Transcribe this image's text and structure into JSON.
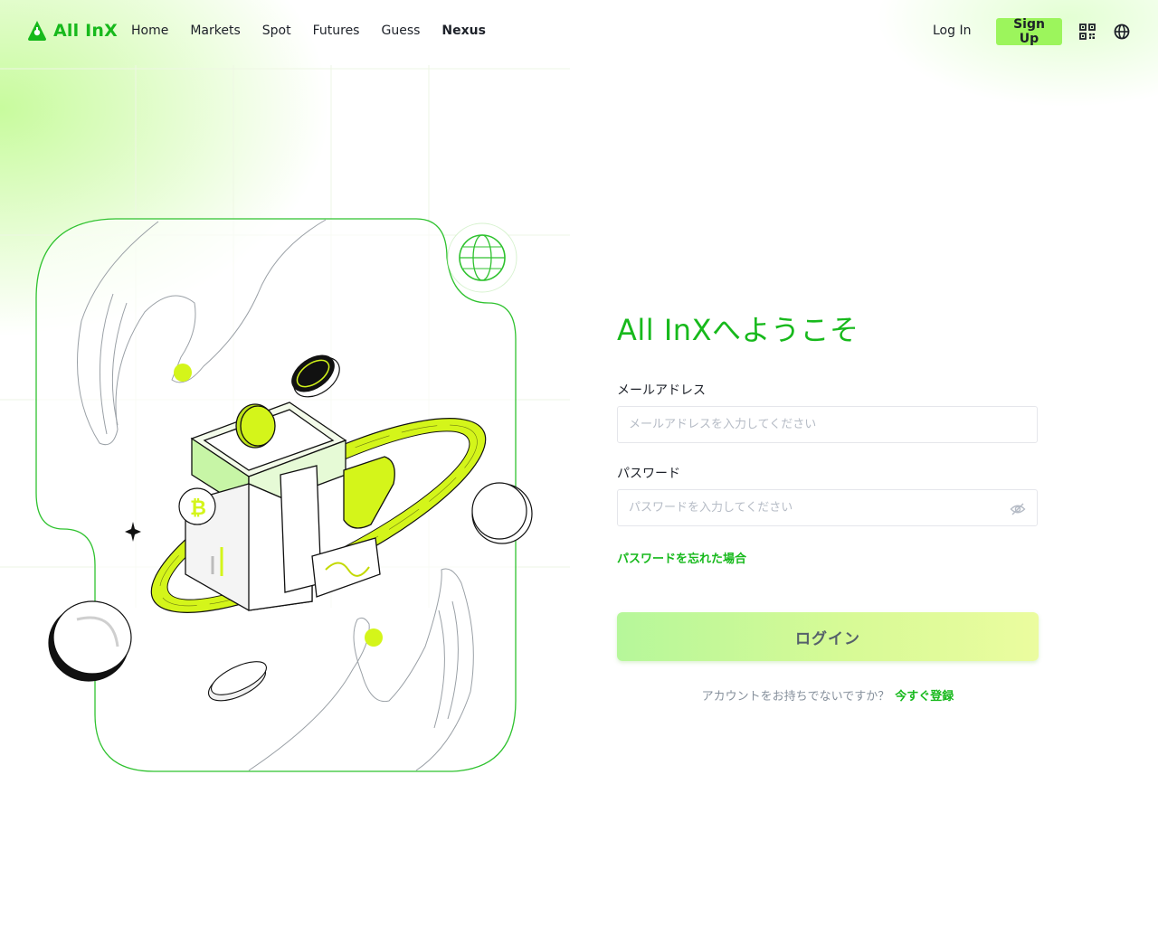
{
  "header": {
    "logo_text": "All InX",
    "nav": [
      {
        "label": "Home"
      },
      {
        "label": "Markets"
      },
      {
        "label": "Spot"
      },
      {
        "label": "Futures"
      },
      {
        "label": "Guess"
      },
      {
        "label": "Nexus"
      }
    ],
    "login_label": "Log In",
    "signup_label": "Sign Up",
    "icons": [
      "qr-code-icon",
      "globe-icon"
    ]
  },
  "form": {
    "title": "All InXへようこそ",
    "email_label": "メールアドレス",
    "email_placeholder": "メールアドレスを入力してください",
    "password_label": "パスワード",
    "password_placeholder": "パスワードを入力してください",
    "forgot_password": "パスワードを忘れた場合",
    "login_button": "ログイン",
    "no_account_text": "アカウントをお持ちでないですか？",
    "register_link": "今すぐ登録"
  },
  "colors": {
    "brand": "#17b91c",
    "accent": "#9cf55c",
    "lime": "#d4f51a"
  }
}
